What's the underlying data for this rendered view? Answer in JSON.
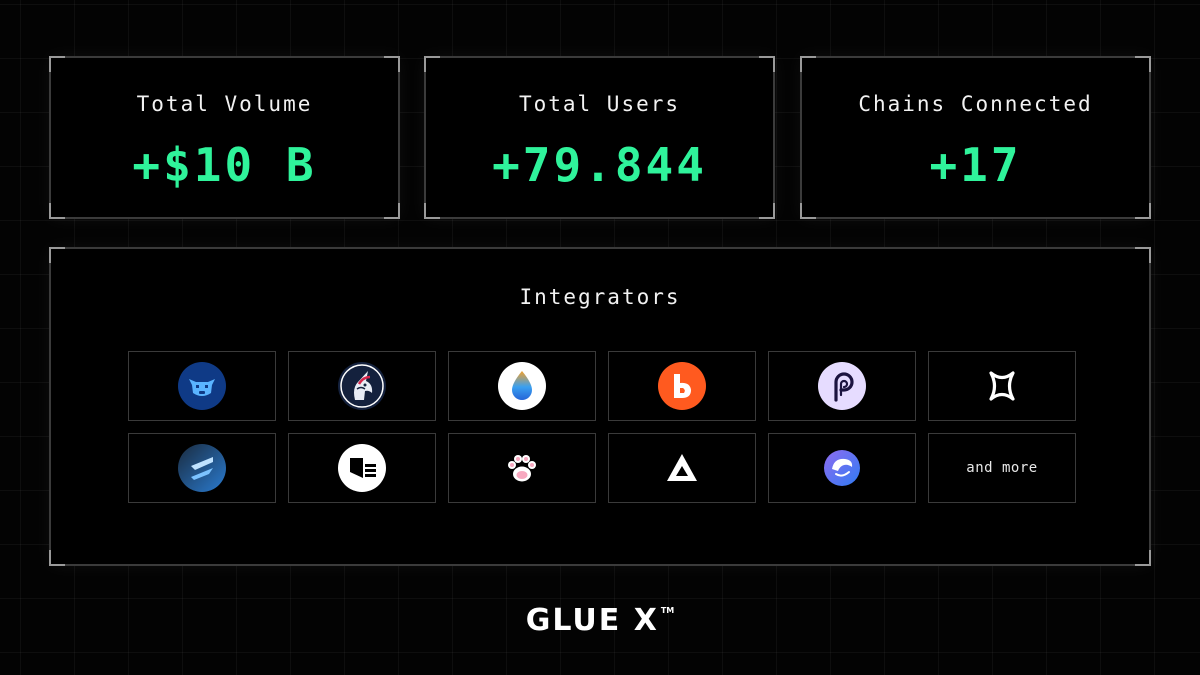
{
  "stats": [
    {
      "label": "Total Volume",
      "value": "+$10 B"
    },
    {
      "label": "Total Users",
      "value": "+79.844"
    },
    {
      "label": "Chains Connected",
      "value": "+17"
    }
  ],
  "integrators": {
    "title": "Integrators",
    "logos": [
      "cow-logo-icon",
      "unicorn-logo-icon",
      "droplet-logo-icon",
      "orange-b-logo-icon",
      "p-logo-icon",
      "x-logo-icon",
      "stripes-logo-icon",
      "stacked-bars-logo-icon",
      "paw-logo-icon",
      "triangle-logo-icon",
      "blue-face-logo-icon"
    ],
    "more_label": "and more"
  },
  "brand": {
    "name": "GLUE X",
    "mark": "TM"
  },
  "colors": {
    "accent": "#2ff39b",
    "background": "#030303",
    "panel": "#000000",
    "border": "#3b3b3b"
  }
}
